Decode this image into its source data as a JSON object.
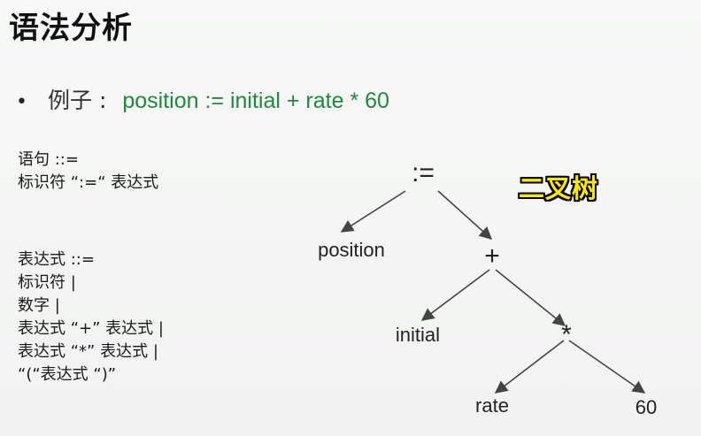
{
  "slide": {
    "title": "语法分析",
    "bullet": "•",
    "example_label": "例子",
    "example_colon": ":",
    "example_expr": "position := initial + rate * 60"
  },
  "grammar": {
    "block1": [
      "语句 ::=",
      "标识符 “:=“ 表达式"
    ],
    "block2": [
      "表达式 ::=",
      "标识符 |",
      "数字 |",
      "表达式 “+” 表达式 |",
      "表达式 “*” 表达式 |",
      "“(“表达式 “)”"
    ]
  },
  "tree": {
    "root": ":=",
    "left_leaf": "position",
    "plus": "+",
    "initial": "initial",
    "times": "*",
    "rate": "rate",
    "sixty": "60"
  },
  "badge": {
    "text": "二叉树",
    "color": "#ffe800"
  }
}
